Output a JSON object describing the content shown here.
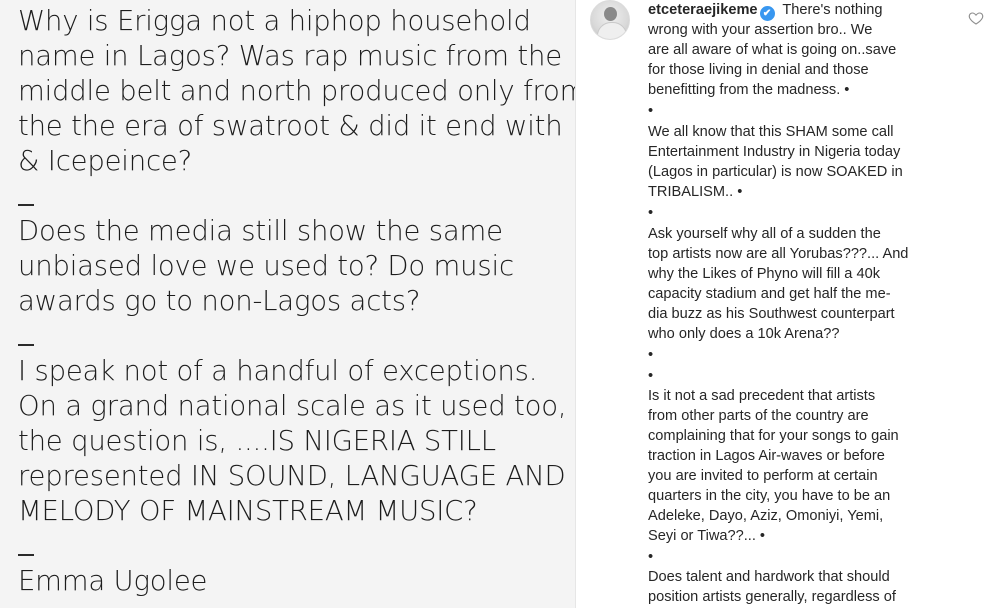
{
  "left_post": {
    "paragraph_1": [
      "Why is Erigga not a hiphop household",
      "name in Lagos? Was rap music from the",
      "middle belt and north produced only from",
      "the the era of swatroot & did it end with MI",
      "& Icepeince?"
    ],
    "paragraph_2": [
      "Does the media still show the same",
      "unbiased love we used to? Do music",
      "awards go to non-Lagos acts?"
    ],
    "paragraph_3": [
      "I speak not of a handful of exceptions.",
      "On a grand national scale as it used too,",
      "the question is, ....IS NIGERIA STILL",
      "represented IN SOUND, LANGUAGE AND",
      "MELODY OF MAINSTREAM MUSIC?"
    ],
    "author": "Emma Ugolee"
  },
  "comment": {
    "username": "etceteraejikeme",
    "verified_icon": "✔",
    "first_line_text": " There's nothing",
    "lines": [
      "wrong with your assertion bro.. We",
      "are all aware of what is going on..save",
      "for those living in denial and those",
      "benefitting from the madness. •",
      "•",
      "We all know that this SHAM some call",
      "Entertainment Industry in Nigeria today",
      "(Lagos in particular) is now SOAKED in",
      "TRIBALISM.. •",
      "•",
      "Ask yourself why all of a sudden the",
      "top artists now are all Yorubas???... And",
      "why the Likes of Phyno will fill a 40k",
      "capacity stadium and get half the me-",
      "dia buzz as his Southwest counterpart",
      "who only does a 10k Arena??",
      "•",
      "•",
      "Is it not a sad precedent that artists",
      "from other parts of the country are",
      "complaining that for your songs to gain",
      "traction in Lagos Air-waves or before",
      "you are invited to perform at certain",
      "quarters in the city, you have to be an",
      "Adeleke, Dayo, Aziz, Omoniyi, Yemi,",
      "Seyi or Tiwa??... •",
      "•",
      "Does talent and hardwork that should",
      "position artists generally, regardless of"
    ]
  },
  "icons": {
    "heart": "heart-outline-icon",
    "avatar": "avatar-image"
  },
  "colors": {
    "left_background": "#f4f4f4",
    "verified_badge": "#3897f0",
    "text": "#262626"
  }
}
